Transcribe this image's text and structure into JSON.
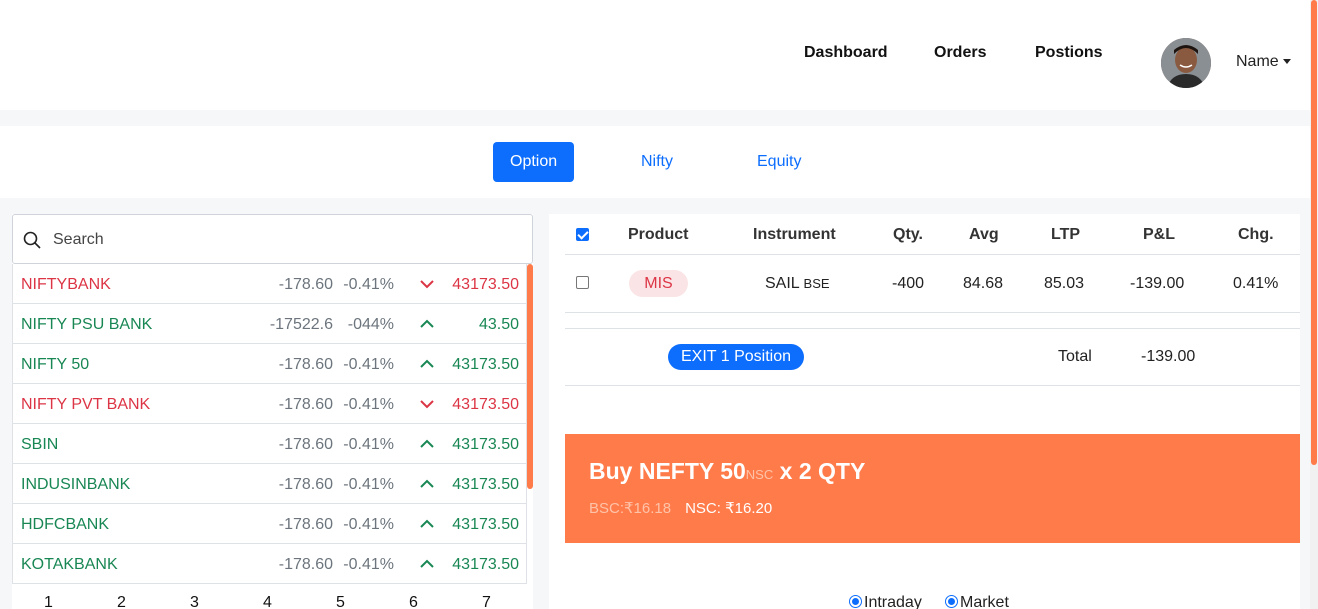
{
  "nav": {
    "links": [
      "Dashboard",
      "Orders",
      "Postions"
    ],
    "user_name": "Name"
  },
  "tabs": [
    "Option",
    "Nifty",
    "Equity"
  ],
  "active_tab": "Option",
  "search": {
    "placeholder": "Search"
  },
  "watchlist": [
    {
      "name": "NIFTYBANK",
      "change": "-178.60",
      "pct": "-0.41%",
      "dir": "down",
      "ltp": "43173.50"
    },
    {
      "name": "NIFTY PSU BANK",
      "change": "-17522.6",
      "pct": "-044%",
      "dir": "up",
      "ltp": "43.50"
    },
    {
      "name": "NIFTY 50",
      "change": "-178.60",
      "pct": "-0.41%",
      "dir": "up",
      "ltp": "43173.50"
    },
    {
      "name": "NIFTY PVT BANK",
      "change": "-178.60",
      "pct": "-0.41%",
      "dir": "down",
      "ltp": "43173.50"
    },
    {
      "name": "SBIN",
      "change": "-178.60",
      "pct": "-0.41%",
      "dir": "up",
      "ltp": "43173.50"
    },
    {
      "name": "INDUSINBANK",
      "change": "-178.60",
      "pct": "-0.41%",
      "dir": "up",
      "ltp": "43173.50"
    },
    {
      "name": "HDFCBANK",
      "change": "-178.60",
      "pct": "-0.41%",
      "dir": "up",
      "ltp": "43173.50"
    },
    {
      "name": "KOTAKBANK",
      "change": "-178.60",
      "pct": "-0.41%",
      "dir": "up",
      "ltp": "43173.50"
    }
  ],
  "pages": [
    "1",
    "2",
    "3",
    "4",
    "5",
    "6",
    "7"
  ],
  "positions": {
    "headers": [
      "Product",
      "Instrument",
      "Qty.",
      "Avg",
      "LTP",
      "P&L",
      "Chg."
    ],
    "row": {
      "product": "MIS",
      "instrument": "SAIL",
      "exchange": "BSE",
      "qty": "-400",
      "avg": "84.68",
      "ltp": "85.03",
      "pnl": "-139.00",
      "chg": "0.41%"
    },
    "exit_label": "EXIT 1 Position",
    "total_label": "Total",
    "total_value": "-139.00"
  },
  "order": {
    "title_main": "Buy NEFTY 50",
    "title_exchange": "NSC",
    "title_qty": "x 2 QTY",
    "bsc_price": "BSC:₹16.18",
    "nsc_price": "NSC: ₹16.20"
  },
  "options": {
    "product": "Intraday",
    "type": "Market"
  },
  "colors": {
    "accent": "#0d6efd",
    "orange": "#ff7b4a",
    "red": "#dc3545",
    "green": "#198754"
  }
}
